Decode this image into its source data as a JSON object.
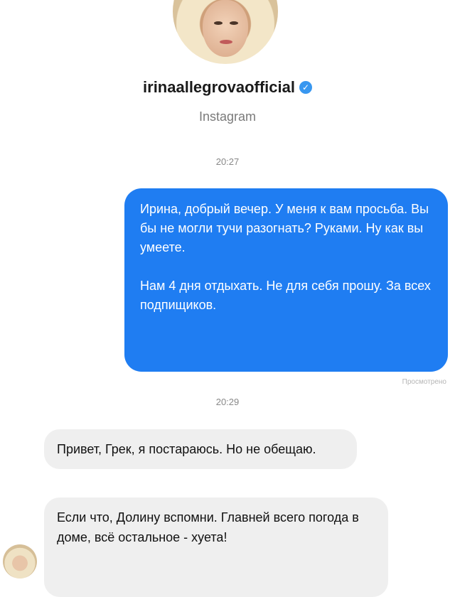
{
  "profile": {
    "username": "irinaallegrovaofficial",
    "platform": "Instagram"
  },
  "messages": {
    "time_1": "20:27",
    "outgoing_p1": "Ирина, добрый вечер. У меня к вам просьба. Вы бы не могли тучи разогнать? Руками. Ну как вы умеете.",
    "outgoing_p2": "Нам 4 дня отдыхать. Не для себя прошу. За всех подпищиков.",
    "seen": "Просмотрено",
    "time_2": "20:29",
    "incoming_1": "Привет, Грек, я постараюсь. Но не обещаю.",
    "incoming_2": "Если что, Долину вспомни. Главней всего погода в доме, всё остальное - хуета!"
  },
  "colors": {
    "outgoing_bubble": "#1f7df2",
    "incoming_bubble": "#efefef",
    "verified_badge": "#3897f0"
  }
}
